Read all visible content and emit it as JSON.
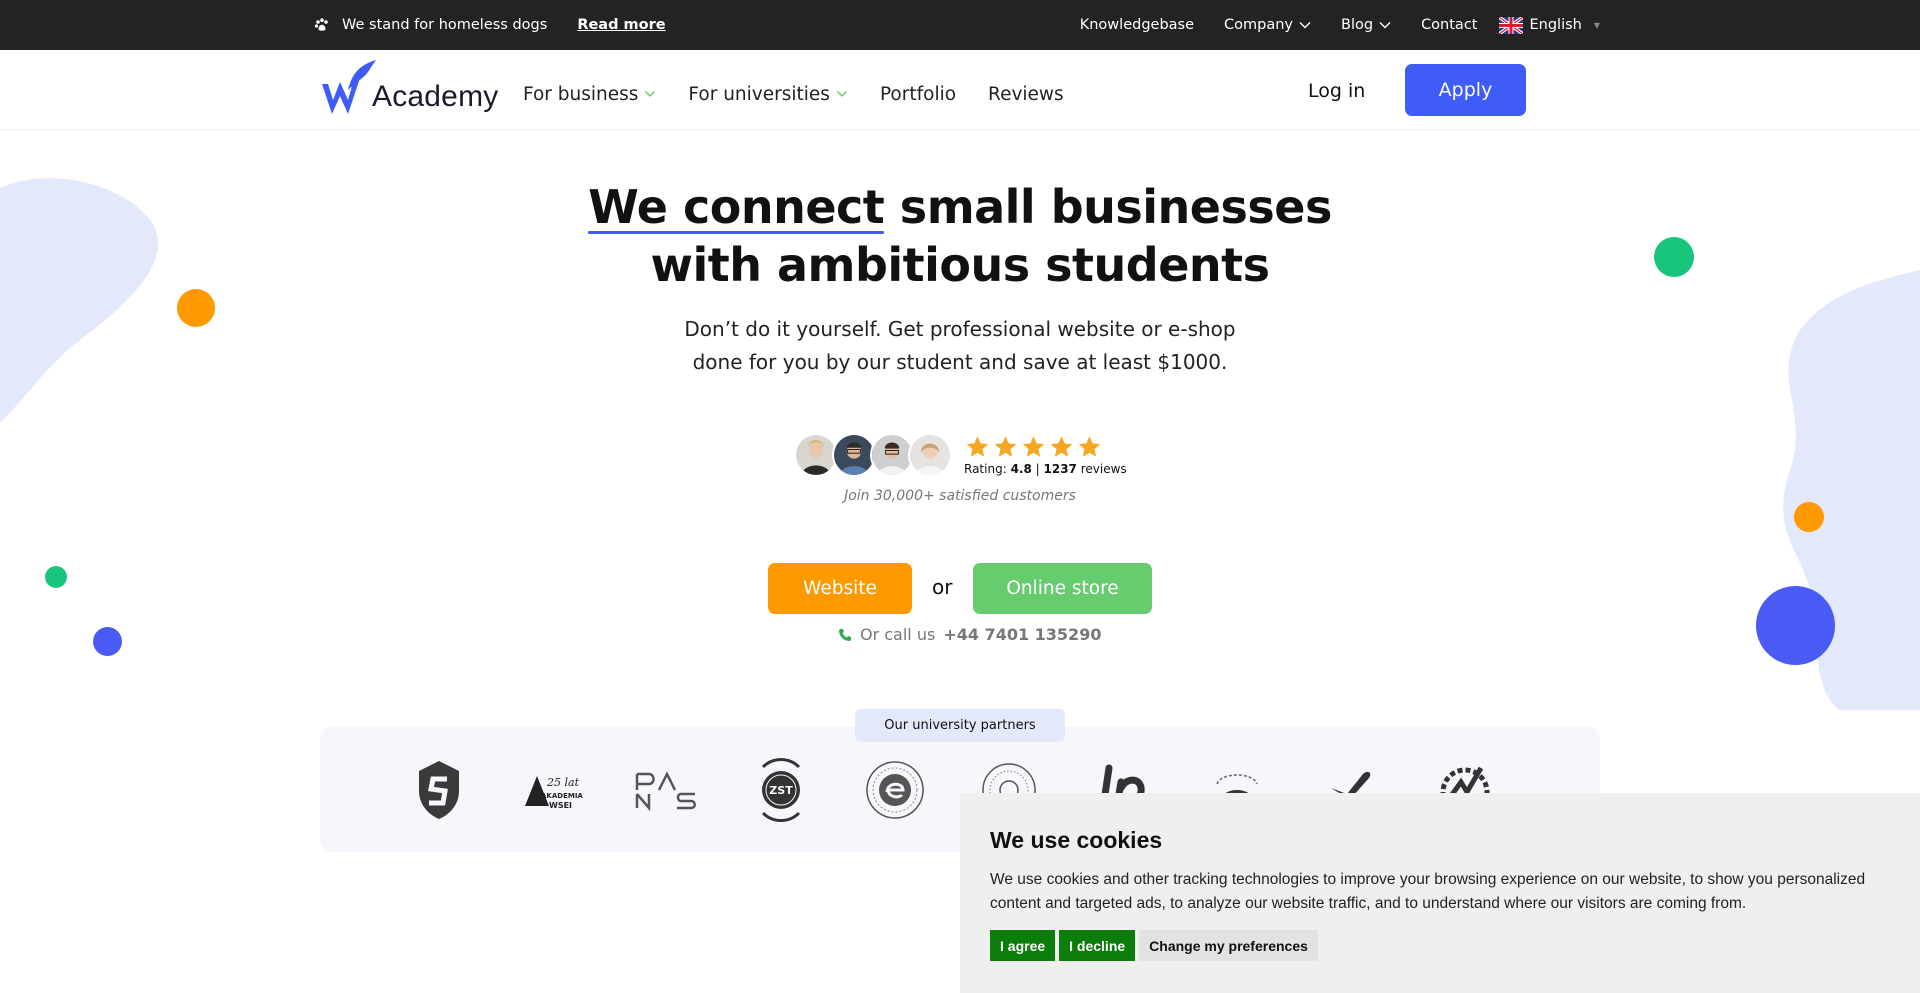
{
  "topbar": {
    "notice": "We stand for homeless dogs",
    "read_more": "Read more",
    "links": [
      "Knowledgebase",
      "Company",
      "Blog",
      "Contact"
    ],
    "language": "English"
  },
  "header": {
    "logo_text": "Academy",
    "nav": [
      "For business",
      "For universities",
      "Portfolio",
      "Reviews"
    ],
    "login": "Log in",
    "apply": "Apply"
  },
  "hero": {
    "title_underlined": "We connect",
    "title_rest": " small businesses",
    "title_line2": "with ambitious students",
    "subtitle_line1": "Don’t do it yourself. Get professional website or e-shop",
    "subtitle_line2": "done for you by our student and save at least $1000.",
    "rating_label": "Rating:",
    "rating_value": "4.8",
    "rating_sep": " | ",
    "review_count": "1237",
    "reviews_word": " reviews",
    "stars": 5,
    "join_text": "Join 30,000+ satisfied customers",
    "website_button": "Website",
    "or_text": "or",
    "store_button": "Online store",
    "call_text": "Or call us",
    "phone": "+44 7401 135290"
  },
  "partners": {
    "label": "Our university partners",
    "logo_text_akademia_years": "25 lat",
    "logo_text_akademia": "AKADEMIA",
    "logo_text_wsei": "WSEI",
    "logo_text_zst": "ZST"
  },
  "cookies": {
    "title": "We use cookies",
    "text": "We use cookies and other tracking technologies to improve your browsing experience on our website, to show you personalized content and targeted ads, to analyze our website traffic, and to understand where our visitors are coming from.",
    "agree": "I agree",
    "decline": "I decline",
    "preferences": "Change my preferences"
  },
  "colors": {
    "brand_blue": "#3f5cf7",
    "orange": "#ff9900",
    "green": "#66cc6e",
    "cookie_green": "#0a7d0a",
    "topbar": "#232323",
    "blob": "#e4e8fb"
  }
}
